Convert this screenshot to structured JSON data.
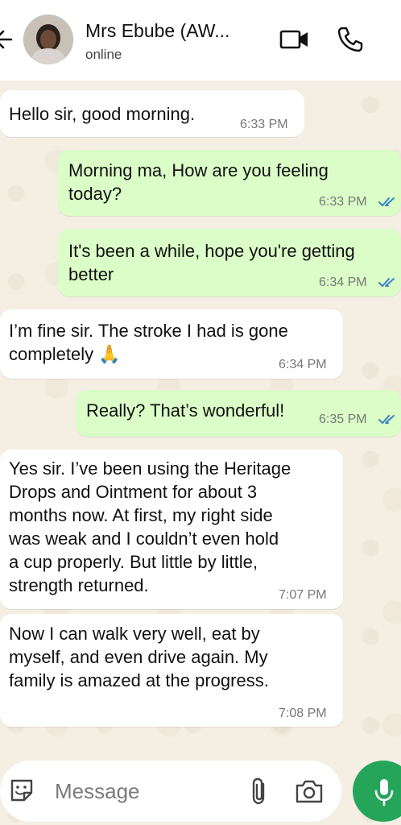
{
  "header": {
    "contact_name": "Mrs Ebube (AW...",
    "status": "online"
  },
  "messages": [
    {
      "direction": "incoming",
      "text": "Hello sir, good morning.",
      "time": "6:33 PM"
    },
    {
      "direction": "outgoing",
      "text": "Morning ma, How are you feeling\ntoday?",
      "time": "6:33 PM",
      "read": true
    },
    {
      "direction": "outgoing",
      "text": "It's been a while,  hope you're getting\nbetter",
      "time": "6:34 PM",
      "read": true
    },
    {
      "direction": "incoming",
      "text": "I’m fine sir. The stroke I had is gone\ncompletely 🙏",
      "time": "6:34 PM"
    },
    {
      "direction": "outgoing",
      "text": "Really? That’s wonderful!",
      "time": "6:35 PM",
      "read": true
    },
    {
      "direction": "incoming",
      "text": "Yes sir. I’ve been using the Heritage\nDrops and Ointment for about 3\nmonths now. At first, my right side\nwas weak and I couldn’t even hold\na cup properly. But little by little,\nstrength returned.",
      "time": "7:07 PM"
    },
    {
      "direction": "incoming",
      "text": "Now I can walk very well, eat by\nmyself, and even drive again. My\nfamily is amazed at the progress.",
      "time": "7:08 PM"
    }
  ],
  "composer": {
    "placeholder": "Message"
  },
  "colors": {
    "outgoing_bubble": "#dbfdc7",
    "incoming_bubble": "#ffffff",
    "mic_button": "#25a55a",
    "read_ticks": "#3b82c4"
  },
  "icons": [
    "back-arrow-icon",
    "video-call-icon",
    "phone-icon",
    "sticker-icon",
    "attach-icon",
    "camera-icon",
    "mic-icon",
    "double-check-icon"
  ]
}
